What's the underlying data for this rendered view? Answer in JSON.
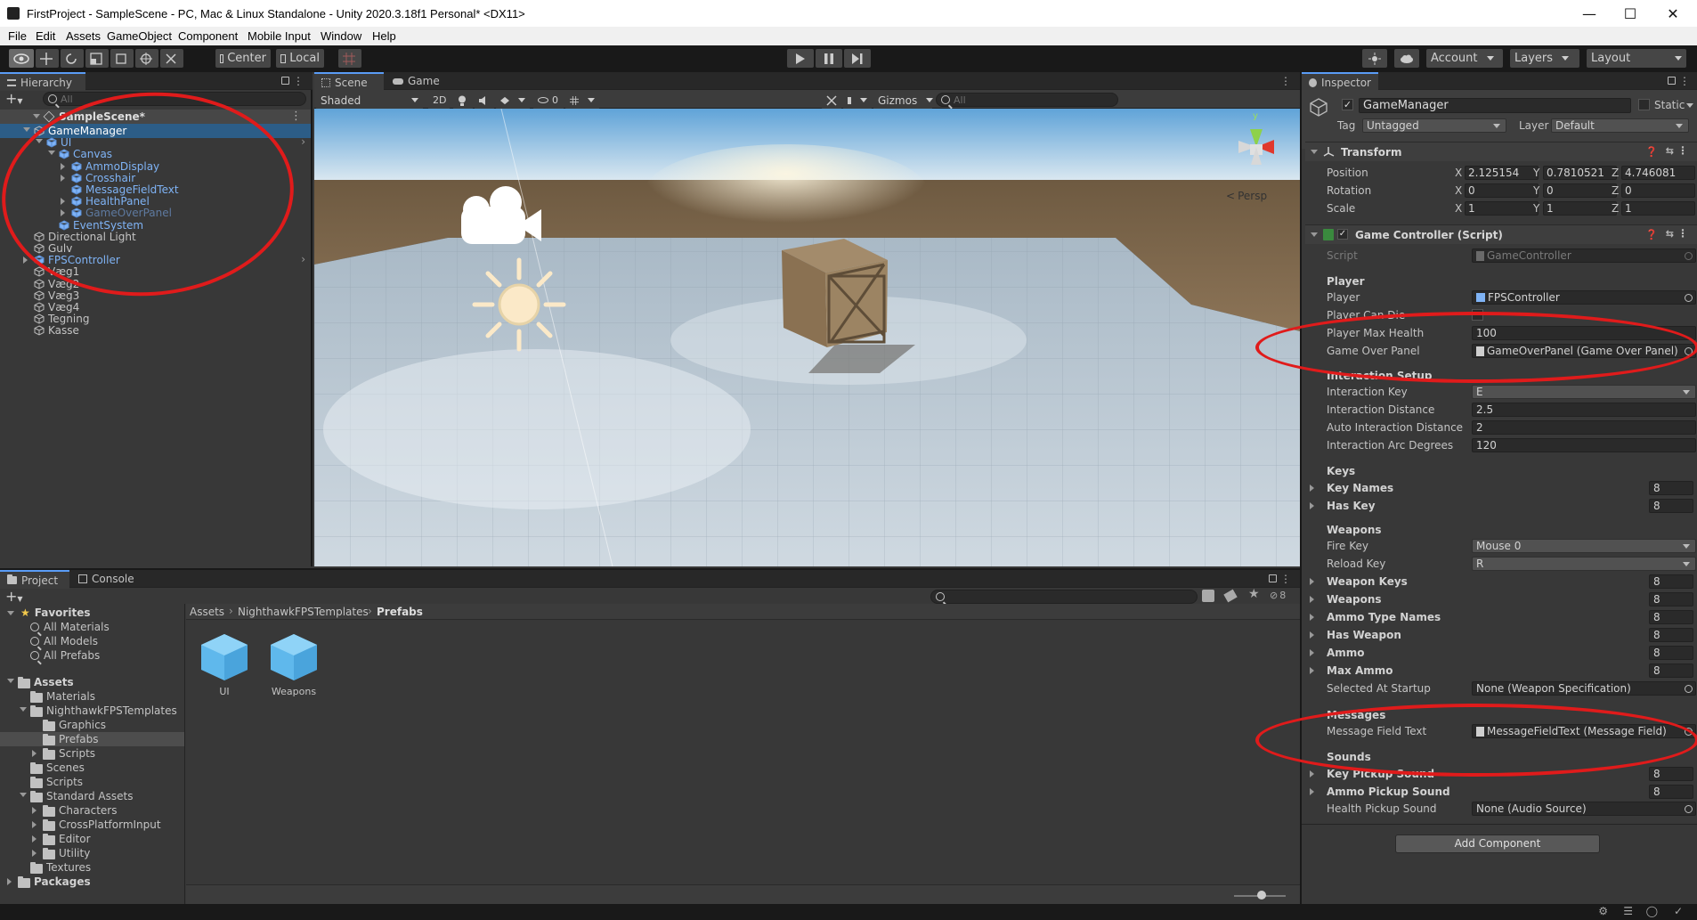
{
  "window": {
    "title": "FirstProject - SampleScene - PC, Mac & Linux Standalone - Unity 2020.3.18f1 Personal* <DX11>"
  },
  "menu": [
    "File",
    "Edit",
    "Assets",
    "GameObject",
    "Component",
    "Mobile Input",
    "Window",
    "Help"
  ],
  "toolbar": {
    "pivot": "Center",
    "space": "Local",
    "account": "Account",
    "layers": "Layers",
    "layout": "Layout"
  },
  "hierarchy": {
    "tab": "Hierarchy",
    "search_placeholder": "All",
    "scene": "SampleScene*",
    "items": [
      {
        "label": "GameManager",
        "depth": 1,
        "selected": true,
        "fold": "open"
      },
      {
        "label": "UI",
        "depth": 2,
        "color": "blue",
        "fold": "open",
        "arrow": true
      },
      {
        "label": "Canvas",
        "depth": 3,
        "color": "blue",
        "fold": "open"
      },
      {
        "label": "AmmoDisplay",
        "depth": 4,
        "color": "blue",
        "fold": "closed"
      },
      {
        "label": "Crosshair",
        "depth": 4,
        "color": "blue",
        "fold": "closed"
      },
      {
        "label": "MessageFieldText",
        "depth": 4,
        "color": "blue"
      },
      {
        "label": "HealthPanel",
        "depth": 4,
        "color": "blue",
        "fold": "closed"
      },
      {
        "label": "GameOverPanel",
        "depth": 4,
        "color": "dim",
        "fold": "closed"
      },
      {
        "label": "EventSystem",
        "depth": 3,
        "color": "blue"
      },
      {
        "label": "Directional Light",
        "depth": 1
      },
      {
        "label": "Gulv",
        "depth": 1
      },
      {
        "label": "FPSController",
        "depth": 1,
        "color": "blue",
        "fold": "closed",
        "arrow": true
      },
      {
        "label": "Væg1",
        "depth": 1
      },
      {
        "label": "Væg2",
        "depth": 1
      },
      {
        "label": "Væg3",
        "depth": 1
      },
      {
        "label": "Væg4",
        "depth": 1
      },
      {
        "label": "Tegning",
        "depth": 1
      },
      {
        "label": "Kasse",
        "depth": 1
      }
    ]
  },
  "scene": {
    "tab_scene": "Scene",
    "tab_game": "Game",
    "shading": "Shaded",
    "mode_2d": "2D",
    "hidden_count": "0",
    "gizmos": "Gizmos",
    "search_placeholder": "All",
    "persp": "Persp",
    "gizmo_y": "y"
  },
  "project": {
    "tab_project": "Project",
    "tab_console": "Console",
    "hidden_count": "8",
    "breadcrumb": [
      "Assets",
      "NighthawkFPSTemplates",
      "Prefabs"
    ],
    "favorites_label": "Favorites",
    "favorites": [
      "All Materials",
      "All Models",
      "All Prefabs"
    ],
    "tree": [
      {
        "label": "Assets",
        "depth": 0,
        "bold": true,
        "fold": "open"
      },
      {
        "label": "Materials",
        "depth": 1
      },
      {
        "label": "NighthawkFPSTemplates",
        "depth": 1,
        "fold": "open"
      },
      {
        "label": "Graphics",
        "depth": 2
      },
      {
        "label": "Prefabs",
        "depth": 2,
        "selected": true
      },
      {
        "label": "Scripts",
        "depth": 2,
        "fold": "closed"
      },
      {
        "label": "Scenes",
        "depth": 1
      },
      {
        "label": "Scripts",
        "depth": 1
      },
      {
        "label": "Standard Assets",
        "depth": 1,
        "fold": "open"
      },
      {
        "label": "Characters",
        "depth": 2,
        "fold": "closed"
      },
      {
        "label": "CrossPlatformInput",
        "depth": 2,
        "fold": "closed"
      },
      {
        "label": "Editor",
        "depth": 2,
        "fold": "closed"
      },
      {
        "label": "Utility",
        "depth": 2,
        "fold": "closed"
      },
      {
        "label": "Textures",
        "depth": 1
      },
      {
        "label": "Packages",
        "depth": 0,
        "bold": true,
        "fold": "closed"
      }
    ],
    "assets": [
      "UI",
      "Weapons"
    ]
  },
  "inspector": {
    "tab": "Inspector",
    "object_name": "GameManager",
    "static_label": "Static",
    "tag_label": "Tag",
    "tag_value": "Untagged",
    "layer_label": "Layer",
    "layer_value": "Default",
    "transform": {
      "title": "Transform",
      "rows": [
        {
          "label": "Position",
          "x": "2.125154",
          "y": "0.7810521",
          "z": "4.746081"
        },
        {
          "label": "Rotation",
          "x": "0",
          "y": "0",
          "z": "0"
        },
        {
          "label": "Scale",
          "x": "1",
          "y": "1",
          "z": "1"
        }
      ]
    },
    "component": {
      "title": "Game Controller (Script)",
      "script_label": "Script",
      "script_value": "GameController"
    },
    "sections": {
      "player": "Player",
      "interaction": "Interaction Setup",
      "keys": "Keys",
      "weapons": "Weapons",
      "messages": "Messages",
      "sounds": "Sounds"
    },
    "fields": {
      "player": {
        "label": "Player",
        "value": "FPSController"
      },
      "player_can_die": {
        "label": "Player Can Die"
      },
      "player_max_health": {
        "label": "Player Max Health",
        "value": "100"
      },
      "game_over_panel": {
        "label": "Game Over Panel",
        "value": "GameOverPanel (Game Over Panel)"
      },
      "interaction_key": {
        "label": "Interaction Key",
        "value": "E"
      },
      "interaction_distance": {
        "label": "Interaction Distance",
        "value": "2.5"
      },
      "auto_interaction_distance": {
        "label": "Auto Interaction Distance",
        "value": "2"
      },
      "interaction_arc_degrees": {
        "label": "Interaction Arc Degrees",
        "value": "120"
      },
      "key_names": {
        "label": "Key Names",
        "value": "8"
      },
      "has_key": {
        "label": "Has Key",
        "value": "8"
      },
      "fire_key": {
        "label": "Fire Key",
        "value": "Mouse 0"
      },
      "reload_key": {
        "label": "Reload Key",
        "value": "R"
      },
      "weapon_keys": {
        "label": "Weapon Keys",
        "value": "8"
      },
      "weapons": {
        "label": "Weapons",
        "value": "8"
      },
      "ammo_type_names": {
        "label": "Ammo Type Names",
        "value": "8"
      },
      "has_weapon": {
        "label": "Has Weapon",
        "value": "8"
      },
      "ammo": {
        "label": "Ammo",
        "value": "8"
      },
      "max_ammo": {
        "label": "Max Ammo",
        "value": "8"
      },
      "selected_at_startup": {
        "label": "Selected At Startup",
        "value": "None (Weapon Specification)"
      },
      "message_field_text": {
        "label": "Message Field Text",
        "value": "MessageFieldText (Message Field)"
      },
      "key_pickup_sound": {
        "label": "Key Pickup Sound",
        "value": "8"
      },
      "ammo_pickup_sound": {
        "label": "Ammo Pickup Sound",
        "value": "8"
      },
      "health_pickup_sound": {
        "label": "Health Pickup Sound",
        "value": "None (Audio Source)"
      }
    },
    "add_component": "Add Component"
  },
  "colors": {
    "accent_blue": "#2c5d87",
    "prefab_blue": "#7fb3f5",
    "annotation_red": "#e01b1b",
    "sky_top": "#5fa3d8",
    "floor": "#c9d4dc"
  }
}
